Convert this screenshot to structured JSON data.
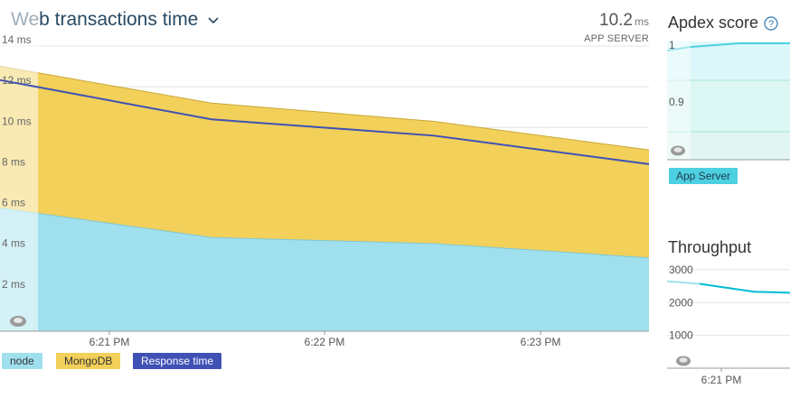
{
  "main": {
    "title": "Web transactions time",
    "summary_value": "10.2",
    "summary_unit": "ms",
    "summary_label": "APP SERVER",
    "legend": [
      {
        "label": "node",
        "color": "#a0e0ee",
        "text_color": "#333333"
      },
      {
        "label": "MongoDB",
        "color": "#f2d05a",
        "text_color": "#333333"
      },
      {
        "label": "Response time",
        "color": "#3f51b5",
        "text_color": "#ffffff"
      }
    ]
  },
  "apdex": {
    "title": "Apdex score",
    "legend_label": "App Server"
  },
  "throughput": {
    "title": "Throughput"
  },
  "chart_data": [
    {
      "type": "area",
      "title": "Web transactions time",
      "x_ticks": [
        "6:21 PM",
        "6:22 PM",
        "6:23 PM"
      ],
      "y_ticks": [
        "2 ms",
        "4 ms",
        "6 ms",
        "8 ms",
        "10 ms",
        "12 ms",
        "14 ms"
      ],
      "ylim": [
        0,
        14
      ],
      "x": [
        "6:20:50 PM",
        "6:21:40 PM",
        "6:22:40 PM",
        "6:23:30 PM"
      ],
      "series": [
        {
          "name": "node",
          "values": [
            5.8,
            4.6,
            4.3,
            3.6
          ],
          "color": "#a0e0ee"
        },
        {
          "name": "MongoDB",
          "values": [
            6.9,
            6.6,
            6.0,
            5.3
          ],
          "color": "#f2d05a"
        },
        {
          "name": "Response time",
          "values": [
            12.0,
            10.4,
            9.6,
            8.2
          ],
          "color": "#3f51b5"
        }
      ],
      "grid": true
    },
    {
      "type": "area",
      "title": "Apdex score",
      "y_ticks": [
        "1",
        "0.9"
      ],
      "ylim": [
        0.8,
        1.0
      ],
      "series": [
        {
          "name": "App Server",
          "values": [
            0.98,
            0.99,
            1.0,
            1.0
          ],
          "color": "#4dd0e1"
        }
      ]
    },
    {
      "type": "line",
      "title": "Throughput",
      "x_ticks": [
        "6:21 PM"
      ],
      "y_ticks": [
        "3000",
        "2000",
        "1000"
      ],
      "ylim": [
        0,
        3300
      ],
      "series": [
        {
          "values": [
            2650,
            2570,
            2330,
            2300
          ],
          "color": "#00bcd4"
        }
      ]
    }
  ]
}
